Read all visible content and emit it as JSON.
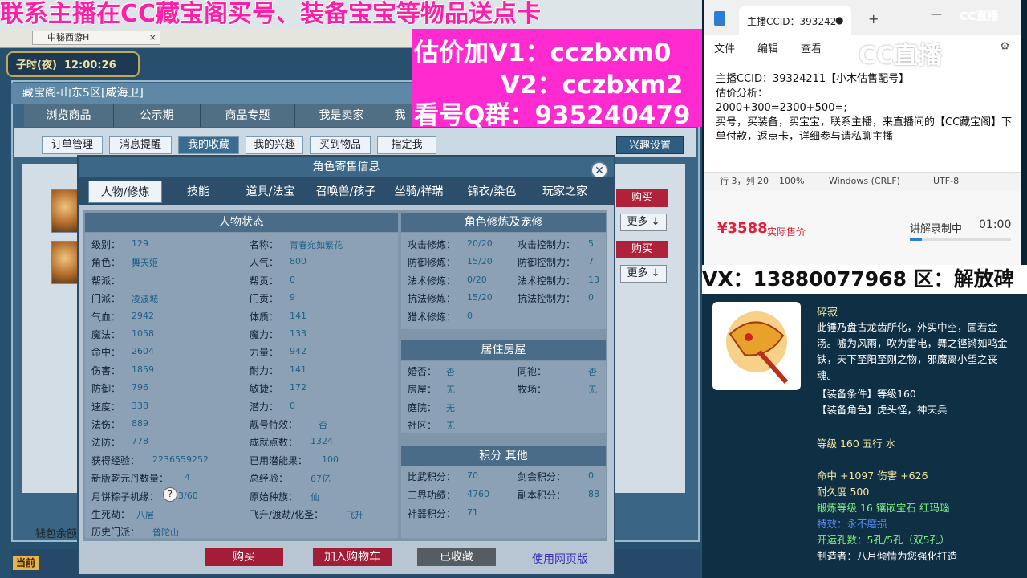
{
  "promo": {
    "line1": "联系主播在CC藏宝阁买号、装备宝宝等物品送点卡",
    "line2": "估价加V1：cczbxm0",
    "line3": "V2：cczbxm2",
    "line4": "看号Q群：935240479"
  },
  "game": {
    "tab_title": "中秘西游H",
    "clock_label": "子时(夜)",
    "clock_time": "12:00:26",
    "window_title": "藏宝阁-山东5区[威海卫]",
    "nav_tabs": [
      "浏览商品",
      "公示期",
      "商品专题",
      "我是卖家",
      "我"
    ],
    "sub_tabs": [
      "订单管理",
      "消息提醒",
      "我的收藏",
      "我的兴趣",
      "买到物品",
      "指定我"
    ],
    "sub_tab_active": "我的收藏",
    "interest_settings": "兴趣设置",
    "buy_label": "购买",
    "more_label": "更多 ↓",
    "wallet_label": "钱包余额",
    "current_label": "当前"
  },
  "dialog": {
    "title": "角色寄售信息",
    "tabs": [
      "人物/修炼",
      "技能",
      "道具/法宝",
      "召唤兽/孩子",
      "坐骑/祥瑞",
      "锦衣/染色",
      "玩家之家"
    ],
    "active_tab": "人物/修炼",
    "status_header": "人物状态",
    "left_col": [
      {
        "label": "级别：",
        "value": "129"
      },
      {
        "label": "角色：",
        "value": "舞天姬"
      },
      {
        "label": "帮派：",
        "value": ""
      },
      {
        "label": "门派：",
        "value": "凌波城"
      },
      {
        "label": "气血：",
        "value": "2942"
      },
      {
        "label": "魔法：",
        "value": "1058"
      },
      {
        "label": "命中：",
        "value": "2604"
      },
      {
        "label": "伤害：",
        "value": "1859"
      },
      {
        "label": "防御：",
        "value": "796"
      },
      {
        "label": "速度：",
        "value": "338"
      },
      {
        "label": "法伤：",
        "value": "889"
      },
      {
        "label": "法防：",
        "value": "778"
      },
      {
        "label": "获得经验：",
        "value": "2236559252"
      },
      {
        "label": "新版乾元丹数量：",
        "value": "4"
      },
      {
        "label": "月饼粽子机缘：",
        "value": "3/60"
      },
      {
        "label": "生死劫：",
        "value": "八层"
      },
      {
        "label": "历史门派：",
        "value": "普陀山"
      }
    ],
    "mid_col": [
      {
        "label": "名称：",
        "value": "青春宛如繁花"
      },
      {
        "label": "人气：",
        "value": "800"
      },
      {
        "label": "帮贡：",
        "value": "0"
      },
      {
        "label": "门贡：",
        "value": "9"
      },
      {
        "label": "体质：",
        "value": "141"
      },
      {
        "label": "魔力：",
        "value": "133"
      },
      {
        "label": "力量：",
        "value": "942"
      },
      {
        "label": "耐力：",
        "value": "141"
      },
      {
        "label": "敏捷：",
        "value": "172"
      },
      {
        "label": "潜力：",
        "value": "0"
      },
      {
        "label": "靓号特效：",
        "value": "否"
      },
      {
        "label": "成就点数：",
        "value": "1324"
      },
      {
        "label": "已用潜能果：",
        "value": "100"
      },
      {
        "label": "总经验：",
        "value": "67亿"
      },
      {
        "label": "原始种族：",
        "value": "仙"
      },
      {
        "label": "飞升/渡劫/化圣：",
        "value": "飞升"
      }
    ],
    "train_header": "角色修炼及宠修",
    "train": [
      {
        "label": "攻击修炼：",
        "value": "20/20",
        "label2": "攻击控制力：",
        "value2": "5"
      },
      {
        "label": "防御修炼：",
        "value": "15/20",
        "label2": "防御控制力：",
        "value2": "7"
      },
      {
        "label": "法术修炼：",
        "value": "0/20",
        "label2": "法术控制力：",
        "value2": "13"
      },
      {
        "label": "抗法修炼：",
        "value": "15/20",
        "label2": "抗法控制力：",
        "value2": "0"
      },
      {
        "label": "猎术修炼：",
        "value": "0",
        "label2": "",
        "value2": ""
      }
    ],
    "house_header": "居住房屋",
    "house": [
      {
        "label": "婚否：",
        "value": "否",
        "label2": "同袍：",
        "value2": "否"
      },
      {
        "label": "房屋：",
        "value": "无",
        "label2": "牧场：",
        "value2": "无"
      },
      {
        "label": "庭院：",
        "value": "无",
        "label2": "",
        "value2": ""
      },
      {
        "label": "社区：",
        "value": "无",
        "label2": "",
        "value2": ""
      }
    ],
    "score_header": "积分 其他",
    "score": [
      {
        "label": "比武积分：",
        "value": "70",
        "label2": "剑会积分：",
        "value2": "0"
      },
      {
        "label": "三界功绩：",
        "value": "4760",
        "label2": "副本积分：",
        "value2": "88"
      },
      {
        "label": "神器积分：",
        "value": "71",
        "label2": "",
        "value2": ""
      }
    ],
    "btn_buy": "购买",
    "btn_cart": "加入购物车",
    "btn_fav": "已收藏",
    "link_web": "使用网页版",
    "qmark": "?"
  },
  "notepad": {
    "tab_title": "主播CCID：393242",
    "menu": [
      "文件",
      "编辑",
      "查看"
    ],
    "lines": [
      "主播CCID：39324211【小木估售配号】",
      "估价分析：",
      "2000+300=2300+500=;",
      "买号，买装备，买宝宝，联系主播，来直播间的【CC藏宝阁】下单付款，返点卡，详细参与请私聊主播"
    ],
    "status": [
      "行 3，列 20",
      "100%",
      "Windows (CRLF)",
      "UTF-8"
    ]
  },
  "watermark": "CC直播",
  "price": {
    "amount": "¥3588",
    "note": "实际售价",
    "recording": "讲解录制中",
    "time": "01:00"
  },
  "vx_bar": "VX：13880077968 区：解放碑",
  "item": {
    "name": "碎寂",
    "desc": "此锤乃盘古龙齿所化，外实中空，固若金汤。嘘为风雨，吹为雷电，舞之铿锵如鸣金铁，天下至阳至刚之物，邪魔离小望之丧魂。",
    "req_level": "【装备条件】等级160",
    "req_role": "【装备角色】虎头怪，神天兵",
    "level": "等级 160  五行 水",
    "stats": "命中 +1097 伤害 +626",
    "durability": "耐久度 500",
    "forge": "锻炼等级 16  镶嵌宝石 红玛瑙",
    "special": "特效：永不磨损",
    "holes": "开运孔数：5孔/5孔（双5孔）",
    "maker": "制造者：八月倾情为您强化打造"
  }
}
